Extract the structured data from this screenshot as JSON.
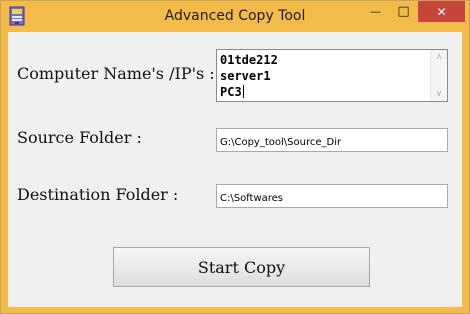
{
  "window": {
    "title": "Advanced Copy Tool",
    "minimize_glyph": "—",
    "maximize_glyph": "□",
    "close_glyph": "✕",
    "app_icon": "app-icon",
    "accent_color": "#f3bb4a",
    "close_color": "#c7463b"
  },
  "form": {
    "computers_label": "Computer Name's /IP's :",
    "computers_lines": [
      "01tde212",
      "server1",
      "PC3"
    ],
    "source_label": "Source Folder :",
    "source_value": "G:\\Copy_tool\\Source_Dir",
    "destination_label": "Destination Folder :",
    "destination_value": "C:\\Softwares",
    "start_button": "Start Copy"
  }
}
